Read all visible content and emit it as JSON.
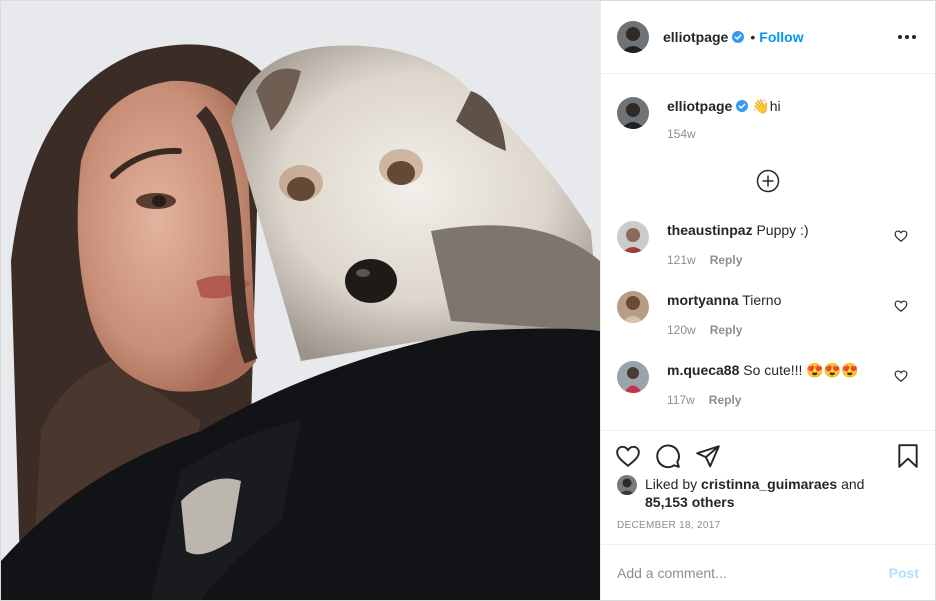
{
  "post": {
    "author": "elliotpage",
    "follow_label": "Follow",
    "dot": "•",
    "caption_text": "hi",
    "caption_emoji": "👋",
    "caption_age": "154w",
    "date": "DECEMBER 18, 2017"
  },
  "comments": [
    {
      "user": "theaustinpaz",
      "text": "Puppy :)",
      "age": "121w",
      "reply_label": "Reply"
    },
    {
      "user": "mortyanna",
      "text": "Tierno",
      "age": "120w",
      "reply_label": "Reply"
    },
    {
      "user": "m.queca88",
      "text": "So cute!!! 😍😍😍",
      "age": "117w",
      "reply_label": "Reply"
    }
  ],
  "likes": {
    "prefix": "Liked by",
    "user": "cristinna_guimaraes",
    "conj": "and",
    "others": "85,153 others"
  },
  "add_comment": {
    "placeholder": "Add a comment...",
    "post_label": "Post"
  },
  "colors": {
    "accent": "#0095f6",
    "verified": "#3897f0",
    "post_disabled": "#b2dffc",
    "muted": "#8e8e8e"
  },
  "icons": [
    "more-options-icon",
    "verified-icon",
    "load-more-icon",
    "heart-icon",
    "comment-icon",
    "share-icon",
    "bookmark-icon"
  ]
}
